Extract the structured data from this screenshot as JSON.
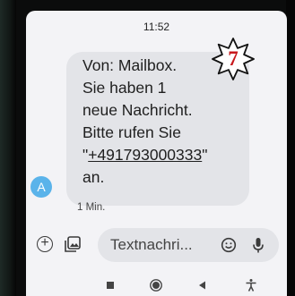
{
  "status": {
    "time": "11:52"
  },
  "step_badge": {
    "number": "7"
  },
  "message": {
    "lines": [
      "Von: Mailbox.",
      "Sie haben 1",
      "neue Nachricht.",
      "Bitte rufen Sie"
    ],
    "phone_open_quote": "\"",
    "phone_number": "+491793000333",
    "phone_close_quote": "\"",
    "last_line": "an.",
    "sender_initial": "A",
    "time_ago": "1 Min."
  },
  "compose": {
    "placeholder": "Textnachri..."
  },
  "icons": {
    "add": "plus-circle-icon",
    "gallery": "gallery-icon",
    "emoji": "emoji-icon",
    "mic": "microphone-icon",
    "nav_recents": "square-icon",
    "nav_home": "circle-icon",
    "nav_back": "triangle-back-icon",
    "nav_accessibility": "accessibility-icon"
  },
  "colors": {
    "screen_bg": "#f3f3f6",
    "bubble_bg": "#e3e4e8",
    "avatar_bg": "#5ab3ea",
    "badge_number": "#c8181c"
  }
}
